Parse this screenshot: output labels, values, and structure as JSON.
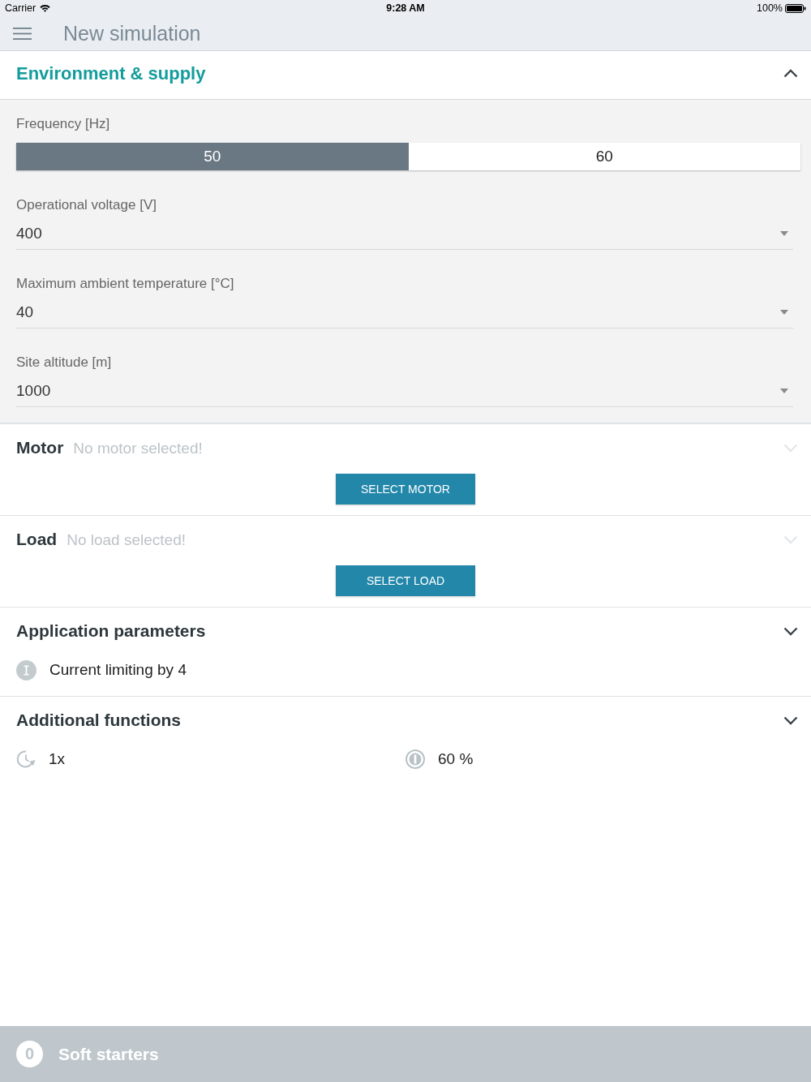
{
  "status_bar": {
    "carrier": "Carrier",
    "time": "9:28 AM",
    "battery": "100%"
  },
  "nav_bar": {
    "title": "New simulation"
  },
  "sections": [
    {
      "kind": "form",
      "title": "Environment & supply",
      "expanded": true,
      "disabled": false,
      "controls": [
        {
          "kind": "segmented",
          "label": "Frequency [Hz]",
          "options": [
            {
              "label": "50",
              "selected": true
            },
            {
              "label": "60",
              "selected": false
            }
          ]
        },
        {
          "kind": "dropdown",
          "label": "Operational voltage [V]",
          "value": "400"
        },
        {
          "kind": "dropdown",
          "label": "Maximum ambient temperature [°C]",
          "value": "40"
        },
        {
          "kind": "dropdown",
          "label": "Site altitude [m]",
          "value": "1000"
        }
      ]
    },
    {
      "kind": "selection",
      "title": "Motor",
      "note": "No motor selected!",
      "expanded": false,
      "disabled": true,
      "button": "SELECT MOTOR"
    },
    {
      "kind": "selection",
      "title": "Load",
      "note": "No load selected!",
      "expanded": false,
      "disabled": true,
      "button": "SELECT LOAD"
    },
    {
      "kind": "summary",
      "title": "Application parameters",
      "expanded": false,
      "disabled": false,
      "items": [
        {
          "kind": "info",
          "text": "Current limiting by 4"
        }
      ]
    },
    {
      "kind": "summary",
      "title": "Additional functions",
      "expanded": false,
      "disabled": false,
      "items": [
        {
          "kind": "repeat",
          "text": "1x"
        },
        {
          "kind": "gauge",
          "text": "60 %"
        }
      ]
    }
  ],
  "footer": {
    "count": "0",
    "label": "Soft starters"
  }
}
